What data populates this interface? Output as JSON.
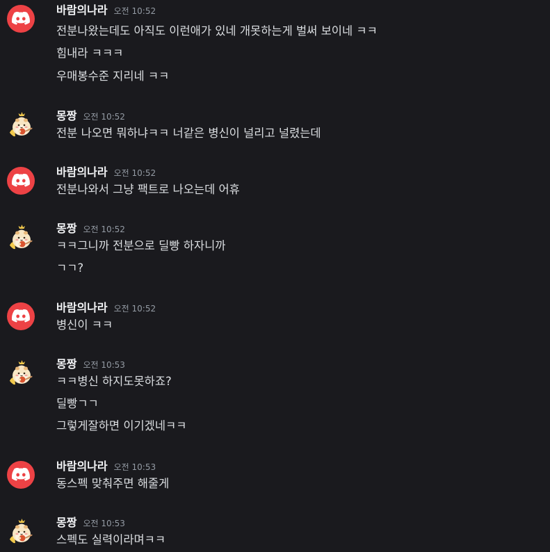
{
  "messages": [
    {
      "author": "바람의나라",
      "avatar": "discord-logo-icon",
      "time": "오전 10:52",
      "lines": [
        "전분나왔는데도 아직도 이런애가 있네 개못하는게 벌써 보이네 ㅋㅋ",
        "힘내라 ㅋㅋㅋ",
        "우매봉수준 지리네 ㅋㅋ"
      ]
    },
    {
      "author": "몽짱",
      "avatar": "hamster-avatar-icon",
      "time": "오전 10:52",
      "lines": [
        "전분 나오면 뭐하냐ㅋㅋ 너같은 병신이 널리고 널렸는데"
      ]
    },
    {
      "author": "바람의나라",
      "avatar": "discord-logo-icon",
      "time": "오전 10:52",
      "lines": [
        "전분나와서 그냥 팩트로 나오는데 어휴"
      ]
    },
    {
      "author": "몽짱",
      "avatar": "hamster-avatar-icon",
      "time": "오전 10:52",
      "lines": [
        "ㅋㅋ그니까 전분으로 딜빵 하자니까",
        "ㄱㄱ?"
      ]
    },
    {
      "author": "바람의나라",
      "avatar": "discord-logo-icon",
      "time": "오전 10:52",
      "lines": [
        "병신이 ㅋㅋ"
      ]
    },
    {
      "author": "몽짱",
      "avatar": "hamster-avatar-icon",
      "time": "오전 10:53",
      "lines": [
        "ㅋㅋ병신 하지도못하죠?",
        "딜빵ㄱㄱ",
        "그렇게잘하면 이기겠네ㅋㅋ"
      ]
    },
    {
      "author": "바람의나라",
      "avatar": "discord-logo-icon",
      "time": "오전 10:53",
      "lines": [
        "동스펙 맞춰주면 해줄게"
      ]
    },
    {
      "author": "몽짱",
      "avatar": "hamster-avatar-icon",
      "time": "오전 10:53",
      "lines": [
        "스펙도 실력이라며ㅋㅋ"
      ]
    }
  ],
  "colors": {
    "background": "#1a1a1e",
    "username": "#f2f3f5",
    "timestamp": "#949ba4",
    "text": "#dbdee1",
    "discord_red": "#ed4245"
  }
}
